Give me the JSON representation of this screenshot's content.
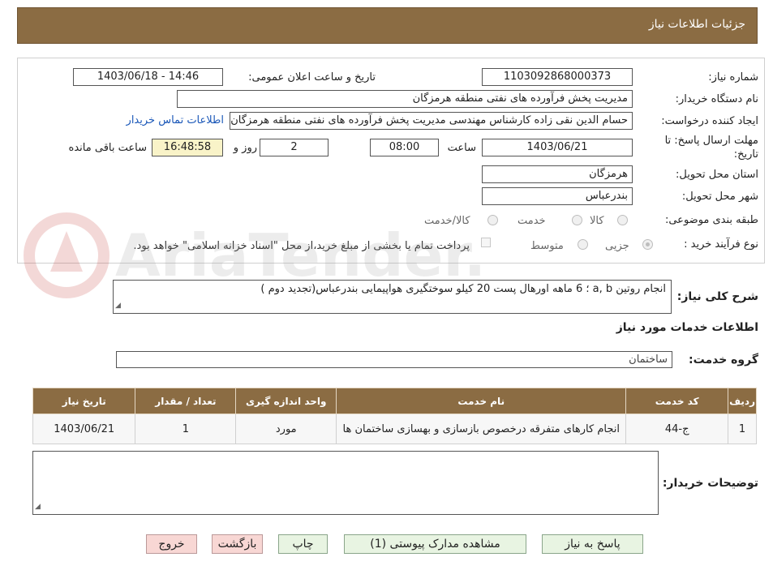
{
  "header": {
    "title": "جزئیات اطلاعات نیاز"
  },
  "form": {
    "need_number_label": "شماره نیاز:",
    "need_number": "1103092868000373",
    "announce_label": "تاریخ و ساعت اعلان عمومی:",
    "announce_value": "1403/06/18 - 14:46",
    "buyer_org_label": "نام دستگاه خریدار:",
    "buyer_org": "مدیریت پخش فرآورده های نفتی منطقه هرمزگان",
    "creator_label": "ایجاد کننده درخواست:",
    "creator": "حسام الدین نقی زاده کارشناس مهندسی مدیریت پخش فرآورده های نفتی منطقه هرمزگان",
    "contact_link": "اطلاعات تماس خریدار",
    "deadline_label": "مهلت ارسال پاسخ: تا تاریخ:",
    "deadline_date": "1403/06/21",
    "time_label": "ساعت",
    "deadline_time": "08:00",
    "days": "2",
    "days_label": "روز و",
    "remaining": "16:48:58",
    "remaining_label": "ساعت باقی مانده",
    "province_label": "استان محل تحویل:",
    "province": "هرمزگان",
    "city_label": "شهر محل تحویل:",
    "city": "بندرعباس",
    "category_label": "طبقه بندی موضوعی:",
    "category_options": [
      "کالا",
      "خدمت",
      "کالا/خدمت"
    ],
    "process_label": "نوع فرآیند خرید :",
    "process_options": [
      "جزیی",
      "متوسط"
    ],
    "payment_note": "پرداخت تمام یا بخشی از مبلغ خرید،از محل \"اسناد خزانه اسلامی\" خواهد بود."
  },
  "summary": {
    "label": "شرح کلی نیاز:",
    "text": "انجام روتین a, b ؛ 6 ماهه اورهال پست 20 کیلو سوختگیری هواپیمایی بندرعباس(تجدید دوم )"
  },
  "services": {
    "section_title": "اطلاعات خدمات مورد نیاز",
    "group_label": "گروه خدمت:",
    "group_value": "ساختمان",
    "columns": [
      "ردیف",
      "کد خدمت",
      "نام خدمت",
      "واحد اندازه گیری",
      "تعداد / مقدار",
      "تاریخ نیاز"
    ],
    "rows": [
      {
        "row": "1",
        "code": "ج-44",
        "name": "انجام کارهای متفرقه درخصوص بازسازی و بهسازی ساختمان ها",
        "unit": "مورد",
        "qty": "1",
        "date": "1403/06/21"
      }
    ]
  },
  "buyer_notes": {
    "label": "توضیحات خریدار:",
    "text": ""
  },
  "buttons": {
    "reply": "پاسخ به نیاز",
    "attachments": "مشاهده مدارک پیوستی (1)",
    "print": "چاپ",
    "back": "بازگشت",
    "exit": "خروج"
  },
  "watermark_text": "AriaTender.neT",
  "colors": {
    "header_bg": "#8b6c43",
    "link": "#1a57b8",
    "remaining_bg": "#f9f3c8"
  }
}
